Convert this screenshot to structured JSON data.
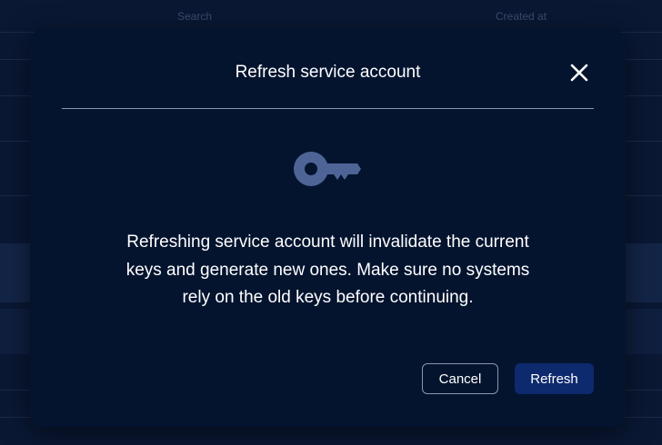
{
  "background": {
    "columns": [
      "Search",
      "Created at"
    ],
    "rows": [
      "",
      "",
      "",
      "",
      "",
      ""
    ]
  },
  "dialog": {
    "title": "Refresh service account",
    "close_icon": "close-icon",
    "key_icon": "key-icon",
    "message": "Refreshing service account will invalidate the current keys and generate new ones. Make sure no systems rely on the old keys before continuing.",
    "cancel_label": "Cancel",
    "refresh_label": "Refresh"
  },
  "colors": {
    "dialog_bg": "#04142f",
    "key_icon": "#4f6496",
    "primary_button": "#0e2a6e"
  }
}
